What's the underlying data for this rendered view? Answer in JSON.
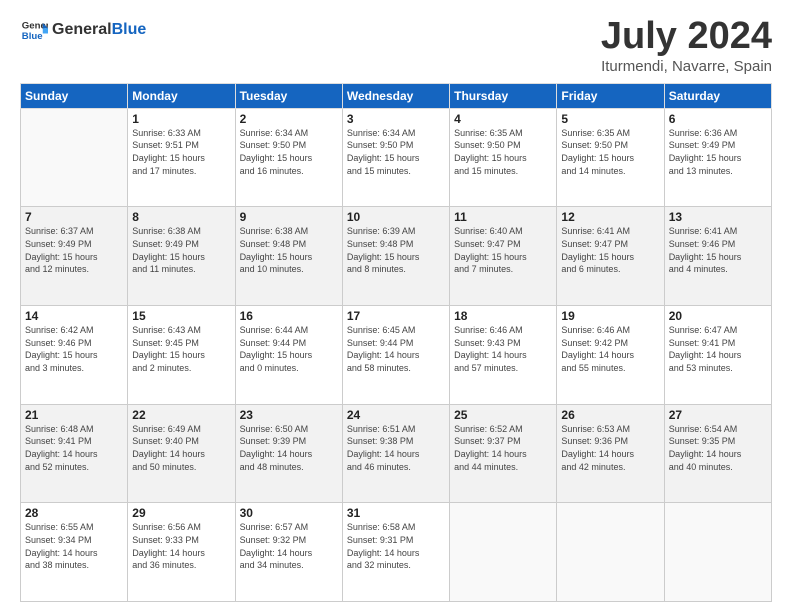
{
  "header": {
    "logo_general": "General",
    "logo_blue": "Blue",
    "month_title": "July 2024",
    "subtitle": "Iturmendi, Navarre, Spain"
  },
  "days_of_week": [
    "Sunday",
    "Monday",
    "Tuesday",
    "Wednesday",
    "Thursday",
    "Friday",
    "Saturday"
  ],
  "weeks": [
    [
      {
        "date": "",
        "info": ""
      },
      {
        "date": "1",
        "info": "Sunrise: 6:33 AM\nSunset: 9:51 PM\nDaylight: 15 hours\nand 17 minutes."
      },
      {
        "date": "2",
        "info": "Sunrise: 6:34 AM\nSunset: 9:50 PM\nDaylight: 15 hours\nand 16 minutes."
      },
      {
        "date": "3",
        "info": "Sunrise: 6:34 AM\nSunset: 9:50 PM\nDaylight: 15 hours\nand 15 minutes."
      },
      {
        "date": "4",
        "info": "Sunrise: 6:35 AM\nSunset: 9:50 PM\nDaylight: 15 hours\nand 15 minutes."
      },
      {
        "date": "5",
        "info": "Sunrise: 6:35 AM\nSunset: 9:50 PM\nDaylight: 15 hours\nand 14 minutes."
      },
      {
        "date": "6",
        "info": "Sunrise: 6:36 AM\nSunset: 9:49 PM\nDaylight: 15 hours\nand 13 minutes."
      }
    ],
    [
      {
        "date": "7",
        "info": "Sunrise: 6:37 AM\nSunset: 9:49 PM\nDaylight: 15 hours\nand 12 minutes."
      },
      {
        "date": "8",
        "info": "Sunrise: 6:38 AM\nSunset: 9:49 PM\nDaylight: 15 hours\nand 11 minutes."
      },
      {
        "date": "9",
        "info": "Sunrise: 6:38 AM\nSunset: 9:48 PM\nDaylight: 15 hours\nand 10 minutes."
      },
      {
        "date": "10",
        "info": "Sunrise: 6:39 AM\nSunset: 9:48 PM\nDaylight: 15 hours\nand 8 minutes."
      },
      {
        "date": "11",
        "info": "Sunrise: 6:40 AM\nSunset: 9:47 PM\nDaylight: 15 hours\nand 7 minutes."
      },
      {
        "date": "12",
        "info": "Sunrise: 6:41 AM\nSunset: 9:47 PM\nDaylight: 15 hours\nand 6 minutes."
      },
      {
        "date": "13",
        "info": "Sunrise: 6:41 AM\nSunset: 9:46 PM\nDaylight: 15 hours\nand 4 minutes."
      }
    ],
    [
      {
        "date": "14",
        "info": "Sunrise: 6:42 AM\nSunset: 9:46 PM\nDaylight: 15 hours\nand 3 minutes."
      },
      {
        "date": "15",
        "info": "Sunrise: 6:43 AM\nSunset: 9:45 PM\nDaylight: 15 hours\nand 2 minutes."
      },
      {
        "date": "16",
        "info": "Sunrise: 6:44 AM\nSunset: 9:44 PM\nDaylight: 15 hours\nand 0 minutes."
      },
      {
        "date": "17",
        "info": "Sunrise: 6:45 AM\nSunset: 9:44 PM\nDaylight: 14 hours\nand 58 minutes."
      },
      {
        "date": "18",
        "info": "Sunrise: 6:46 AM\nSunset: 9:43 PM\nDaylight: 14 hours\nand 57 minutes."
      },
      {
        "date": "19",
        "info": "Sunrise: 6:46 AM\nSunset: 9:42 PM\nDaylight: 14 hours\nand 55 minutes."
      },
      {
        "date": "20",
        "info": "Sunrise: 6:47 AM\nSunset: 9:41 PM\nDaylight: 14 hours\nand 53 minutes."
      }
    ],
    [
      {
        "date": "21",
        "info": "Sunrise: 6:48 AM\nSunset: 9:41 PM\nDaylight: 14 hours\nand 52 minutes."
      },
      {
        "date": "22",
        "info": "Sunrise: 6:49 AM\nSunset: 9:40 PM\nDaylight: 14 hours\nand 50 minutes."
      },
      {
        "date": "23",
        "info": "Sunrise: 6:50 AM\nSunset: 9:39 PM\nDaylight: 14 hours\nand 48 minutes."
      },
      {
        "date": "24",
        "info": "Sunrise: 6:51 AM\nSunset: 9:38 PM\nDaylight: 14 hours\nand 46 minutes."
      },
      {
        "date": "25",
        "info": "Sunrise: 6:52 AM\nSunset: 9:37 PM\nDaylight: 14 hours\nand 44 minutes."
      },
      {
        "date": "26",
        "info": "Sunrise: 6:53 AM\nSunset: 9:36 PM\nDaylight: 14 hours\nand 42 minutes."
      },
      {
        "date": "27",
        "info": "Sunrise: 6:54 AM\nSunset: 9:35 PM\nDaylight: 14 hours\nand 40 minutes."
      }
    ],
    [
      {
        "date": "28",
        "info": "Sunrise: 6:55 AM\nSunset: 9:34 PM\nDaylight: 14 hours\nand 38 minutes."
      },
      {
        "date": "29",
        "info": "Sunrise: 6:56 AM\nSunset: 9:33 PM\nDaylight: 14 hours\nand 36 minutes."
      },
      {
        "date": "30",
        "info": "Sunrise: 6:57 AM\nSunset: 9:32 PM\nDaylight: 14 hours\nand 34 minutes."
      },
      {
        "date": "31",
        "info": "Sunrise: 6:58 AM\nSunset: 9:31 PM\nDaylight: 14 hours\nand 32 minutes."
      },
      {
        "date": "",
        "info": ""
      },
      {
        "date": "",
        "info": ""
      },
      {
        "date": "",
        "info": ""
      }
    ]
  ]
}
